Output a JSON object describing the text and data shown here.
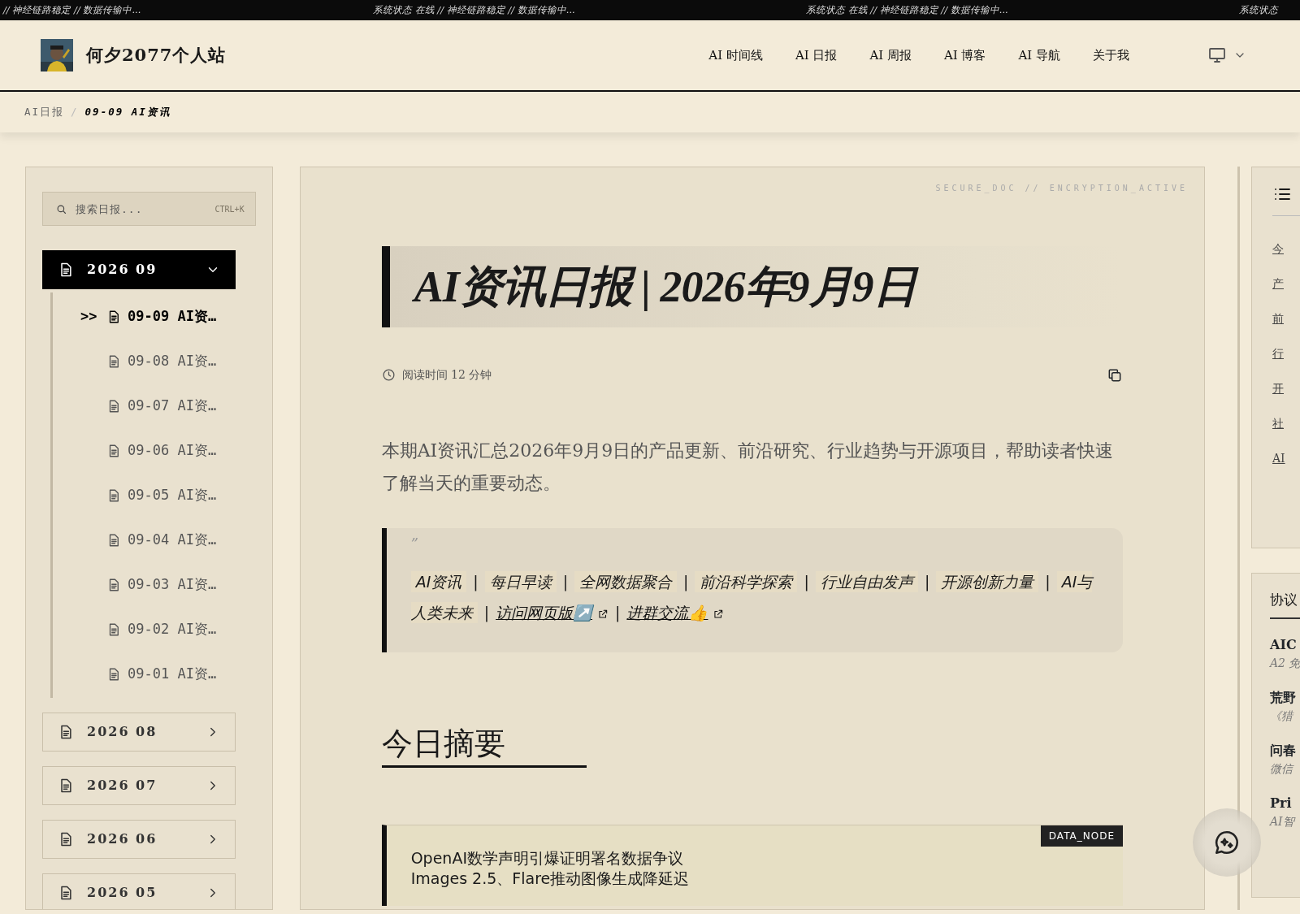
{
  "ticker": [
    "// 神经链路稳定 // 数据传输中...",
    "系统状态 在线 // 神经链路稳定 // 数据传输中...",
    "系统状态 在线 // 神经链路稳定 // 数据传输中...",
    "系统状态"
  ],
  "theme_menu": {
    "expanded": false
  },
  "header": {
    "site_title": "何夕2077个人站",
    "nav": [
      {
        "label": "AI 时间线"
      },
      {
        "label": "AI 日报"
      },
      {
        "label": "AI 周报"
      },
      {
        "label": "AI 博客"
      },
      {
        "label": "AI 导航"
      },
      {
        "label": "关于我"
      }
    ]
  },
  "breadcrumb": [
    {
      "label": "AI日报",
      "selected": false
    },
    {
      "kind": "separator",
      "label": "/"
    },
    {
      "label": "09-09 AI资讯",
      "selected": true
    }
  ],
  "sidebar": {
    "search": {
      "placeholder": "搜索日报...",
      "shortcut": "CTRL+K"
    },
    "months": [
      {
        "label": "2026 09",
        "expanded": true,
        "children": [
          {
            "marker": ">>",
            "label": "09-09 AI资…",
            "selected": true
          },
          {
            "label": "09-08 AI资…",
            "selected": false
          },
          {
            "label": "09-07 AI资…",
            "selected": false
          },
          {
            "label": "09-06 AI资…",
            "selected": false
          },
          {
            "label": "09-05 AI资…",
            "selected": false
          },
          {
            "label": "09-04 AI资…",
            "selected": false
          },
          {
            "label": "09-03 AI资…",
            "selected": false
          },
          {
            "label": "09-02 AI资…",
            "selected": false
          },
          {
            "label": "09-01 AI资…",
            "selected": false
          }
        ]
      },
      {
        "label": "2026 08",
        "expanded": false
      },
      {
        "label": "2026 07",
        "expanded": false
      },
      {
        "label": "2026 06",
        "expanded": false
      },
      {
        "label": "2026 05",
        "expanded": false
      }
    ]
  },
  "article": {
    "watermark": "SECURE_DOC // ENCRYPTION_ACTIVE",
    "title": "AI资讯日报 | 2026年9月9日",
    "reading_time": "阅读时间 12 分钟",
    "summary": "本期AI资讯汇总2026年9月9日的产品更新、前沿研究、行业趋势与开源项目，帮助读者快速了解当天的重要动态。",
    "quote": {
      "mark": "”",
      "segments": [
        {
          "kind": "tag",
          "text": "AI资讯"
        },
        {
          "kind": "sep",
          "text": "|"
        },
        {
          "kind": "tag",
          "text": "每日早读"
        },
        {
          "kind": "sep",
          "text": "|"
        },
        {
          "kind": "tag",
          "text": "全网数据聚合"
        },
        {
          "kind": "sep",
          "text": "|"
        },
        {
          "kind": "tag",
          "text": "前沿科学探索"
        },
        {
          "kind": "sep",
          "text": "|"
        },
        {
          "kind": "tag",
          "text": "行业自由发声"
        },
        {
          "kind": "sep",
          "text": "|"
        },
        {
          "kind": "tag",
          "text": "开源创新力量"
        },
        {
          "kind": "sep",
          "text": "|"
        },
        {
          "kind": "tag",
          "text": "AI与人类未来"
        },
        {
          "kind": "sep",
          "text": "|"
        },
        {
          "kind": "link",
          "text": "访问网页版↗️"
        },
        {
          "kind": "sep",
          "text": "|"
        },
        {
          "kind": "link",
          "text": "进群交流👍"
        }
      ]
    },
    "section_heading": "今日摘要",
    "data_node": {
      "badge": "DATA_NODE",
      "lines": [
        "OpenAI数学声明引爆证明署名数据争议",
        "Images 2.5、Flare推动图像生成降延迟"
      ]
    }
  },
  "toc": {
    "items": [
      "今",
      "产",
      "前",
      "行",
      "开",
      "社",
      "AI"
    ]
  },
  "protocols": {
    "title": "协议",
    "items": [
      {
        "title": "AIC",
        "subtitle": "A2 免"
      },
      {
        "title": "荒野",
        "subtitle": "《猎"
      },
      {
        "title": "问春",
        "subtitle": "微信"
      },
      {
        "title": "Pri",
        "subtitle": "AI智"
      }
    ]
  }
}
